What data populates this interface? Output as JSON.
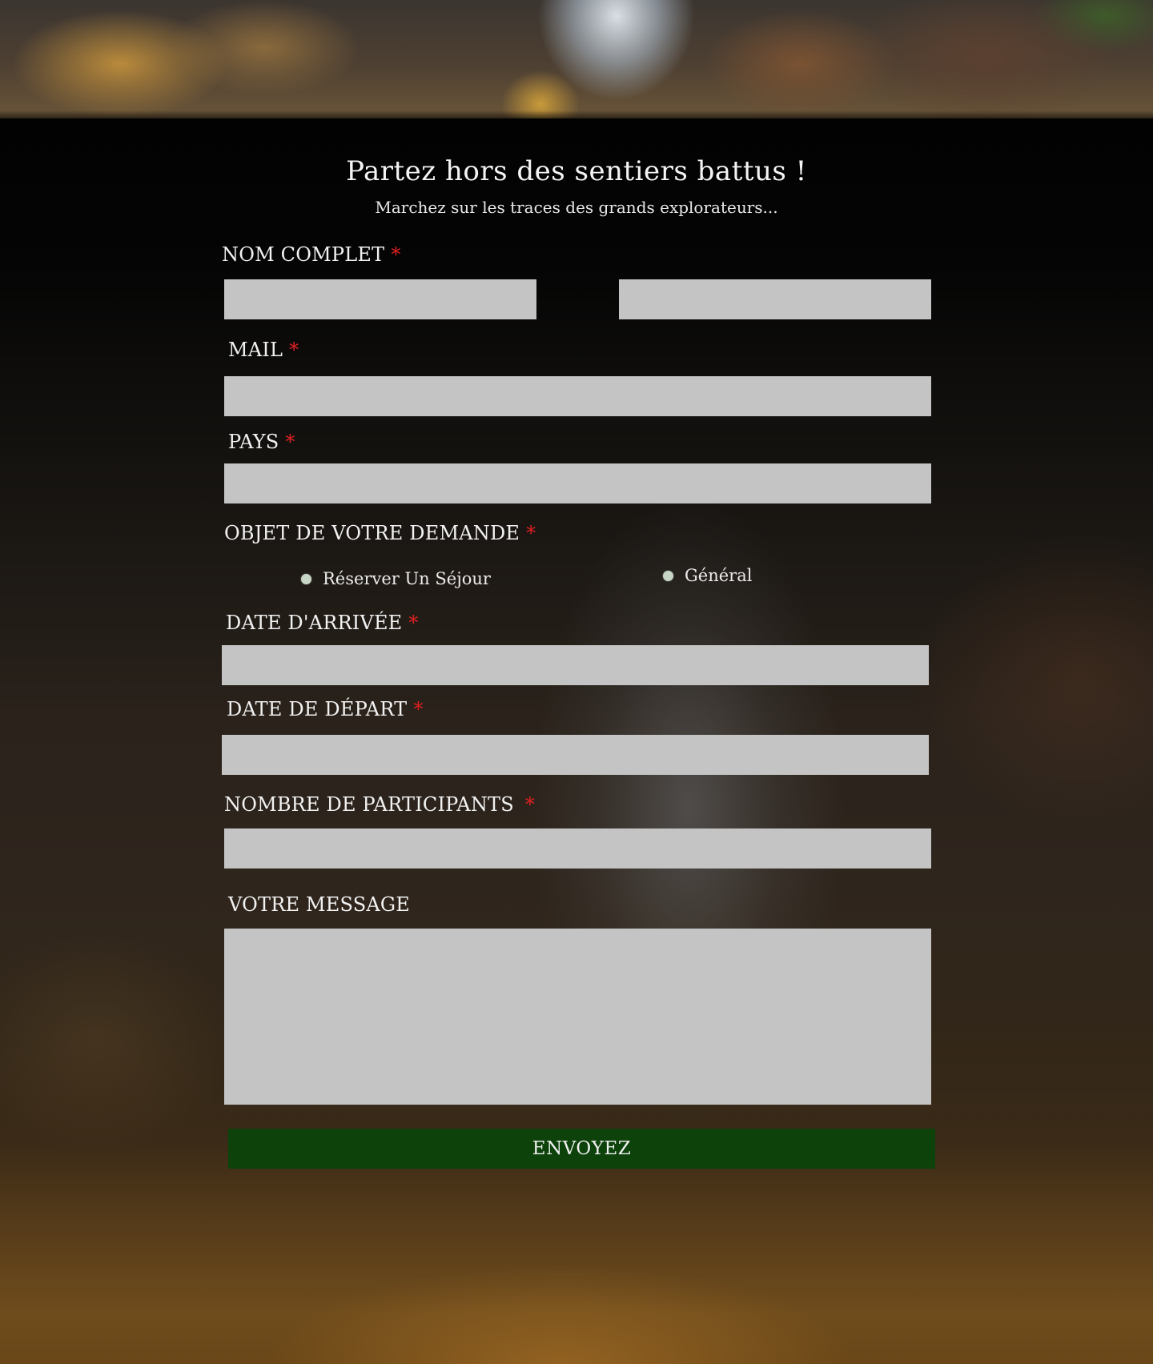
{
  "header": {
    "title": "Partez hors des sentiers battus !",
    "subtitle": "Marchez sur les traces des grands explorateurs..."
  },
  "form": {
    "required_mark": "*",
    "full_name": {
      "label": "NOM COMPLET",
      "first_value": "",
      "last_value": ""
    },
    "mail": {
      "label": "MAIL",
      "value": ""
    },
    "country": {
      "label": "PAYS",
      "value": ""
    },
    "subject": {
      "label": "OBJET DE VOTRE DEMANDE",
      "options": [
        "Réserver Un Séjour",
        "Général"
      ]
    },
    "arrival_date": {
      "label": "DATE D'ARRIVÉE",
      "value": ""
    },
    "departure_date": {
      "label": "DATE DE DÉPART",
      "value": ""
    },
    "participants": {
      "label": "NOMBRE DE PARTICIPANTS",
      "value": ""
    },
    "message": {
      "label": "VOTRE MESSAGE",
      "value": ""
    },
    "submit_label": "ENVOYEZ"
  },
  "colors": {
    "field_bg": "#c4c4c4",
    "required": "#e02020",
    "submit_bg": "#0d420b",
    "radio_dot": "#c8d6c8"
  }
}
